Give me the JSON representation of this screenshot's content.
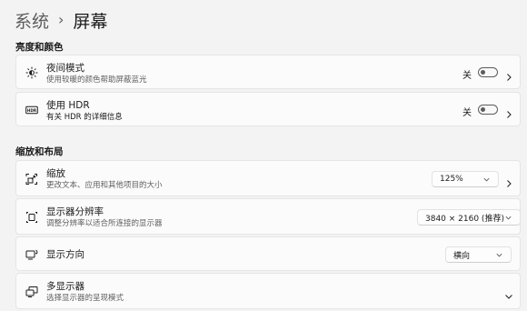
{
  "breadcrumb": {
    "parent": "系统",
    "separator": "›",
    "current": "屏幕"
  },
  "sections": {
    "brightness_color": "亮度和颜色",
    "scale_layout": "缩放和布局"
  },
  "night_light": {
    "title": "夜间模式",
    "desc": "使用较暖的颜色帮助屏蔽蓝光",
    "state": "关",
    "icon": "brightness-icon"
  },
  "hdr": {
    "title": "使用 HDR",
    "desc": "有关 HDR 的详细信息",
    "state": "关",
    "icon": "hdr-icon"
  },
  "scale": {
    "title": "缩放",
    "desc": "更改文本、应用和其他项目的大小",
    "value": "125%",
    "icon": "scale-icon"
  },
  "resolution": {
    "title": "显示器分辨率",
    "desc": "调整分辨率以适合所连接的显示器",
    "value": "3840 × 2160 (推荐)",
    "icon": "resolution-icon"
  },
  "orientation": {
    "title": "显示方向",
    "value": "横向",
    "icon": "orientation-icon"
  },
  "multi_display": {
    "title": "多显示器",
    "desc": "选择显示器的呈现模式",
    "icon": "multi-display-icon"
  }
}
